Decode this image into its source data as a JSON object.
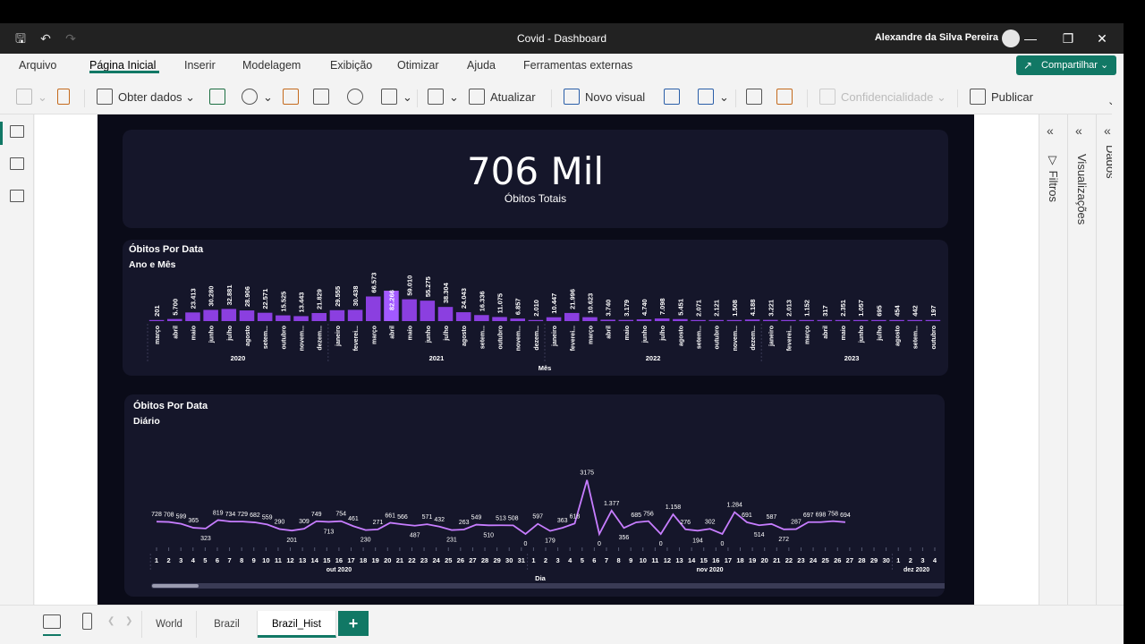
{
  "window": {
    "title": "Covid - Dashboard",
    "user": "Alexandre da Silva Pereira"
  },
  "menu": {
    "items": [
      "Arquivo",
      "Página Inicial",
      "Inserir",
      "Modelagem",
      "Exibição",
      "Otimizar",
      "Ajuda",
      "Ferramentas externas"
    ],
    "active": "Página Inicial",
    "share_label": "Compartilhar"
  },
  "ribbon": {
    "get_data": "Obter dados",
    "refresh": "Atualizar",
    "new_visual": "Novo visual",
    "sensitivity": "Confidencialidade",
    "publish": "Publicar"
  },
  "panes": {
    "filters": "Filtros",
    "visualizations": "Visualizações",
    "data": "Dados"
  },
  "kpi": {
    "value": "706 Mil",
    "label": "Óbitos Totais"
  },
  "pages": {
    "tabs": [
      "World",
      "Brazil",
      "Brazil_Hist"
    ],
    "active": "Brazil_Hist"
  },
  "chart_data": [
    {
      "type": "bar",
      "title": "Óbitos Por Data",
      "subtitle": "Ano e Mês",
      "xlabel": "Mês",
      "accent": "#8b3fe0",
      "highlight": "#a259ff",
      "years": [
        {
          "label": "2020",
          "from": 0,
          "to": 9
        },
        {
          "label": "2021",
          "from": 10,
          "to": 21
        },
        {
          "label": "2022",
          "from": 22,
          "to": 33
        },
        {
          "label": "2023",
          "from": 34,
          "to": 43
        }
      ],
      "categories": [
        "março",
        "abril",
        "maio",
        "junho",
        "julho",
        "agosto",
        "setem...",
        "outubro",
        "novem...",
        "dezem...",
        "janeiro",
        "feverei...",
        "março",
        "abril",
        "maio",
        "junho",
        "julho",
        "agosto",
        "setem...",
        "outubro",
        "novem...",
        "dezem...",
        "janeiro",
        "feverei...",
        "março",
        "abril",
        "maio",
        "junho",
        "julho",
        "agosto",
        "setem...",
        "outubro",
        "novem...",
        "dezem...",
        "janeiro",
        "feverei...",
        "março",
        "abril",
        "maio",
        "junho",
        "julho",
        "agosto",
        "setem...",
        "outubro"
      ],
      "values": [
        201,
        5700,
        23413,
        30280,
        32881,
        28906,
        22571,
        15525,
        13443,
        21829,
        29555,
        30438,
        66573,
        82266,
        59010,
        55275,
        38304,
        24043,
        16336,
        11075,
        6857,
        2010,
        10447,
        21996,
        10623,
        3740,
        3179,
        4740,
        7098,
        5451,
        2071,
        2121,
        1508,
        4188,
        3221,
        2013,
        1152,
        317,
        2351,
        1057,
        695,
        454,
        442,
        197
      ],
      "labels": [
        "201",
        "5.700",
        "23.413",
        "30.280",
        "32.881",
        "28.906",
        "22.571",
        "15.525",
        "13.443",
        "21.829",
        "29.555",
        "30.438",
        "66.573",
        "82.266",
        "59.010",
        "55.275",
        "38.304",
        "24.043",
        "16.336",
        "11.075",
        "6.857",
        "2.010",
        "10.447",
        "21.996",
        "10.623",
        "3.740",
        "3.179",
        "4.740",
        "7.098",
        "5.451",
        "2.071",
        "2.121",
        "1.508",
        "4.188",
        "3.221",
        "2.013",
        "1.152",
        "317",
        "2.351",
        "1.057",
        "695",
        "454",
        "442",
        "197"
      ]
    },
    {
      "type": "line",
      "title": "Óbitos Por Data",
      "subtitle": "Diário",
      "xlabel": "Dia",
      "color": "#c77dff",
      "months": [
        {
          "label": "out 2020",
          "from": 0,
          "to": 30
        },
        {
          "label": "nov 2020",
          "from": 31,
          "to": 60
        },
        {
          "label": "dez 2020",
          "from": 61,
          "to": 64
        }
      ],
      "x": [
        "1",
        "2",
        "3",
        "4",
        "5",
        "6",
        "7",
        "8",
        "9",
        "10",
        "11",
        "12",
        "13",
        "14",
        "15",
        "16",
        "17",
        "18",
        "19",
        "20",
        "21",
        "22",
        "23",
        "24",
        "25",
        "26",
        "27",
        "28",
        "29",
        "30",
        "31",
        "1",
        "2",
        "3",
        "4",
        "5",
        "6",
        "7",
        "8",
        "9",
        "10",
        "11",
        "12",
        "13",
        "14",
        "15",
        "16",
        "17",
        "18",
        "19",
        "20",
        "21",
        "22",
        "23",
        "24",
        "25",
        "26",
        "27",
        "28",
        "29",
        "30",
        "1",
        "2",
        "3",
        "4"
      ],
      "values": [
        728,
        708,
        599,
        365,
        323,
        819,
        734,
        729,
        682,
        559,
        290,
        201,
        309,
        749,
        713,
        754,
        461,
        230,
        271,
        661,
        566,
        487,
        571,
        432,
        231,
        263,
        549,
        510,
        513,
        508,
        0,
        597,
        179,
        363,
        618,
        3175,
        0,
        1377,
        356,
        685,
        756,
        0,
        1158,
        276,
        194,
        302,
        0,
        1284,
        691,
        514,
        587,
        272,
        287,
        697,
        698,
        758,
        694
      ],
      "labels": [
        "728",
        "708",
        "599",
        "365",
        "323",
        "819",
        "734",
        "729",
        "682",
        "559",
        "290",
        "201",
        "309",
        "749",
        "713",
        "754",
        "461",
        "230",
        "271",
        "661",
        "566",
        "487",
        "571",
        "432",
        "231",
        "263",
        "549",
        "510",
        "513",
        "508",
        "0",
        "597",
        "179",
        "363",
        "618",
        "3175",
        "0",
        "1.377",
        "356",
        "685",
        "756",
        "0",
        "1.158",
        "276",
        "194",
        "302",
        "0",
        "1.284",
        "691",
        "514",
        "587",
        "272",
        "287",
        "697",
        "698",
        "758",
        "694"
      ]
    }
  ]
}
